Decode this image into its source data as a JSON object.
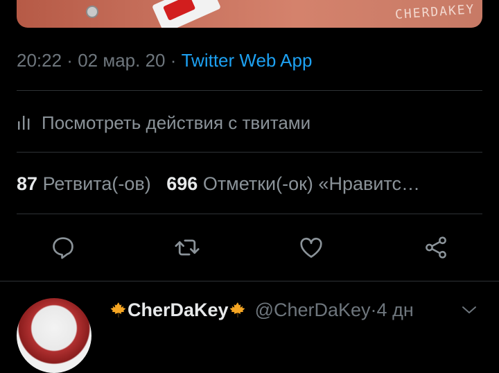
{
  "media": {
    "signature": "CHERDAKEY"
  },
  "tweet": {
    "time": "20:22",
    "sep1": " · ",
    "date": "02 мар. 20",
    "sep2": " · ",
    "app": "Twitter Web App"
  },
  "activity": {
    "label": "Посмотреть действия с твитами"
  },
  "stats": {
    "retweets_count": "87",
    "retweets_label": "Ретвита(-ов)",
    "likes_count": "696",
    "likes_label": "Отметки(-ок) «Нравитс…"
  },
  "actions": {
    "reply_icon": "reply-icon",
    "retweet_icon": "retweet-icon",
    "like_icon": "heart-icon",
    "share_icon": "share-icon"
  },
  "reply": {
    "name": "CherDaKey",
    "handle": "@CherDaKey",
    "sep": " · ",
    "age": "4 дн"
  },
  "colors": {
    "background": "#000000",
    "link": "#1da1f2",
    "muted": "#6e767d",
    "leaf": "#f6a623"
  }
}
